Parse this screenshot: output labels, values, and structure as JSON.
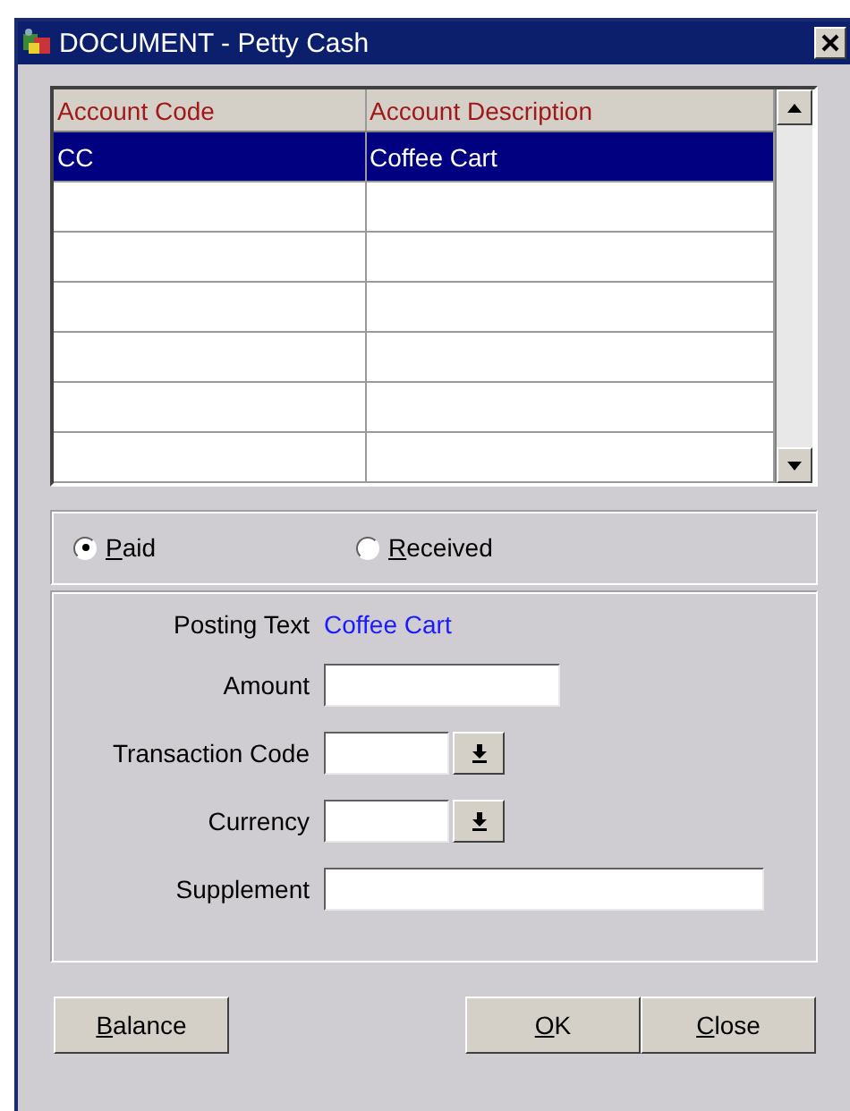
{
  "window": {
    "title": "DOCUMENT - Petty Cash"
  },
  "table": {
    "columns": [
      "Account Code",
      "Account Description"
    ],
    "rows": [
      {
        "cells": [
          "CC",
          "Coffee Cart"
        ],
        "selected": true
      }
    ]
  },
  "type_options": [
    {
      "label": "Paid",
      "selected": true
    },
    {
      "label": "Received",
      "selected": false
    }
  ],
  "posting_text": {
    "label": "Posting Text",
    "value": "Coffee Cart"
  },
  "fields": [
    {
      "label": "Amount",
      "kind": "text"
    },
    {
      "label": "Transaction Code",
      "kind": "dropdown"
    },
    {
      "label": "Currency",
      "kind": "dropdown"
    },
    {
      "label": "Supplement",
      "kind": "wide"
    }
  ],
  "buttons": [
    {
      "label": "Balance"
    },
    {
      "label": "OK"
    },
    {
      "label": "Close"
    }
  ]
}
